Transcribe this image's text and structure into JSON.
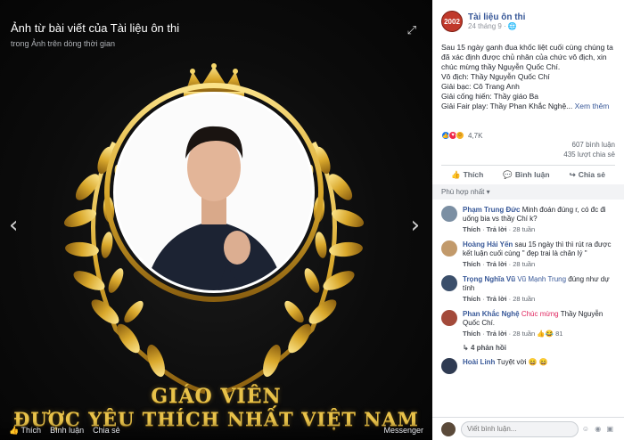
{
  "viewer": {
    "title": "Ảnh từ bài viết của Tài liệu ôn thi",
    "subtitle": "trong Ảnh trên dòng thời gian",
    "banner_line1": "GIÁO VIÊN",
    "banner_line2": "ĐƯỢC YÊU THÍCH NHẤT VIỆT NAM",
    "actions": [
      "Thích",
      "Bình luận",
      "Chia sẻ",
      "Messenger"
    ]
  },
  "post": {
    "page_avatar_text": "2002",
    "page_name": "Tài liệu ôn thi",
    "time": "24 tháng 9 · 🌐",
    "text_lines": [
      "Sau 15 ngày ganh đua khốc liệt cuối cùng chúng ta đã xác định được chủ nhân của chức vô địch, xin chúc mừng thầy Nguyễn Quốc Chí.",
      "Vô địch: Thầy Nguyễn Quốc Chí",
      "Giải bạc: Cô Trang Anh",
      "Giải cống hiến: Thầy giáo Ba",
      "Giải Fair play: Thầy Phan Khắc Nghệ..."
    ],
    "see_more": "Xem thêm",
    "reactions_count": "4,7K",
    "comments_count": "607 bình luận",
    "shares_count": "435 lượt chia sẻ",
    "actions": {
      "like": "Thích",
      "comment": "Bình luận",
      "share": "Chia sẻ"
    },
    "sort_label": "Phù hợp nhất ▾"
  },
  "comments": [
    {
      "name": "Phạm Trung Đức",
      "text": "Minh đoán đúng r, có đc đi uống bia vs thầy Chí k?",
      "like": "Thích",
      "reply": "Trả lời",
      "age": "28 tuần",
      "avatar_color": "#7b8fa3"
    },
    {
      "name": "Hoàng Hải Yến",
      "text": "sau 15 ngày thì thì rút ra được kết luận cuối cùng \" đẹp trai là chân lý \"",
      "like": "Thích",
      "reply": "Trả lời",
      "age": "28 tuần",
      "avatar_color": "#c29a6b"
    },
    {
      "name": "Trọng Nghĩa Vũ",
      "tag": "Vũ Mạnh Trung",
      "text": "đúng như dự tính",
      "like": "Thích",
      "reply": "Trả lời",
      "age": "28 tuần",
      "avatar_color": "#3b4f6b"
    },
    {
      "name": "Phan Khắc Nghệ",
      "tag": "Chúc mừng",
      "text": "Thầy Nguyễn Quốc Chí.",
      "like": "Thích",
      "reply": "Trả lời",
      "age": "28 tuần",
      "avatar_color": "#a34a3a",
      "reaction_count": "81"
    },
    {
      "name": "Hoài Linh",
      "text": "Tuyệt vời 😄 😄",
      "avatar_color": "#2f3b52"
    }
  ],
  "replies_label": "4 phản hồi",
  "write_placeholder": "Viết bình luận..."
}
